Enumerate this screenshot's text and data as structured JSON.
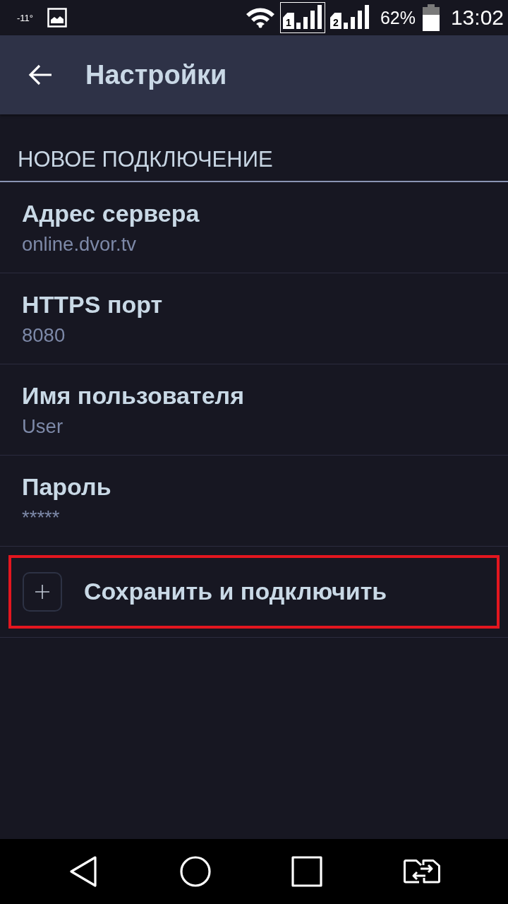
{
  "status_bar": {
    "temperature": "-11°",
    "sims": [
      {
        "label": "1",
        "selected": true
      },
      {
        "label": "2",
        "selected": false
      }
    ],
    "battery": "62%",
    "time": "13:02"
  },
  "app_bar": {
    "title": "Настройки"
  },
  "section": {
    "title": "НОВОЕ ПОДКЛЮЧЕНИЕ"
  },
  "preferences": [
    {
      "title": "Адрес сервера",
      "summary": "online.dvor.tv"
    },
    {
      "title": "HTTPS порт",
      "summary": "8080"
    },
    {
      "title": "Имя пользователя",
      "summary": "User"
    },
    {
      "title": "Пароль",
      "summary": "*****"
    }
  ],
  "action": {
    "label": "Сохранить и подключить",
    "highlighted": true
  }
}
